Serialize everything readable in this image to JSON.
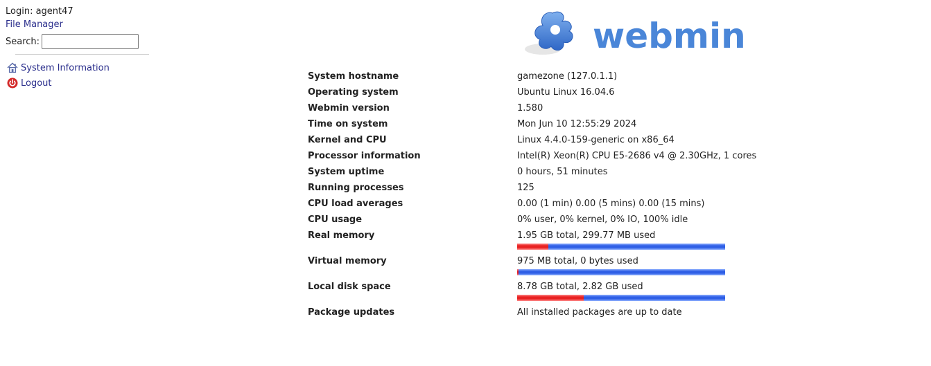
{
  "sidebar": {
    "login_text": "Login: agent47",
    "file_manager_label": "File Manager",
    "search_label": "Search:",
    "search_value": "",
    "items": [
      {
        "label": "System Information",
        "icon": "home-icon"
      },
      {
        "label": "Logout",
        "icon": "power-icon"
      }
    ]
  },
  "logo": {
    "text": "webmin",
    "color": "#4a86d8"
  },
  "system_info": {
    "hostname": {
      "label": "System hostname",
      "value": "gamezone (127.0.1.1)"
    },
    "os": {
      "label": "Operating system",
      "value": "Ubuntu Linux 16.04.6"
    },
    "version": {
      "label": "Webmin version",
      "value": "1.580"
    },
    "time": {
      "label": "Time on system",
      "value": "Mon Jun 10 12:55:29 2024"
    },
    "kernel": {
      "label": "Kernel and CPU",
      "value": "Linux 4.4.0-159-generic on x86_64"
    },
    "processor": {
      "label": "Processor information",
      "value": "Intel(R) Xeon(R) CPU E5-2686 v4 @ 2.30GHz, 1 cores"
    },
    "uptime": {
      "label": "System uptime",
      "value": "0 hours, 51 minutes"
    },
    "processes": {
      "label": "Running processes",
      "value": "125"
    },
    "load": {
      "label": "CPU load averages",
      "value": "0.00 (1 min) 0.00 (5 mins) 0.00 (15 mins)"
    },
    "cpu_usage": {
      "label": "CPU usage",
      "value": "0% user, 0% kernel, 0% IO, 100% idle"
    },
    "real_memory": {
      "label": "Real memory",
      "value": "1.95 GB total, 299.77 MB used",
      "used_fraction": 0.15
    },
    "virtual_memory": {
      "label": "Virtual memory",
      "value": "975 MB total, 0 bytes used",
      "used_fraction": 0.0
    },
    "disk": {
      "label": "Local disk space",
      "value": "8.78 GB total, 2.82 GB used",
      "used_fraction": 0.32
    },
    "packages": {
      "label": "Package updates",
      "value": "All installed packages are up to date"
    }
  },
  "colors": {
    "link": "#2a2e8c",
    "bar_used": "#e82222",
    "bar_free": "#2f5fe6"
  }
}
